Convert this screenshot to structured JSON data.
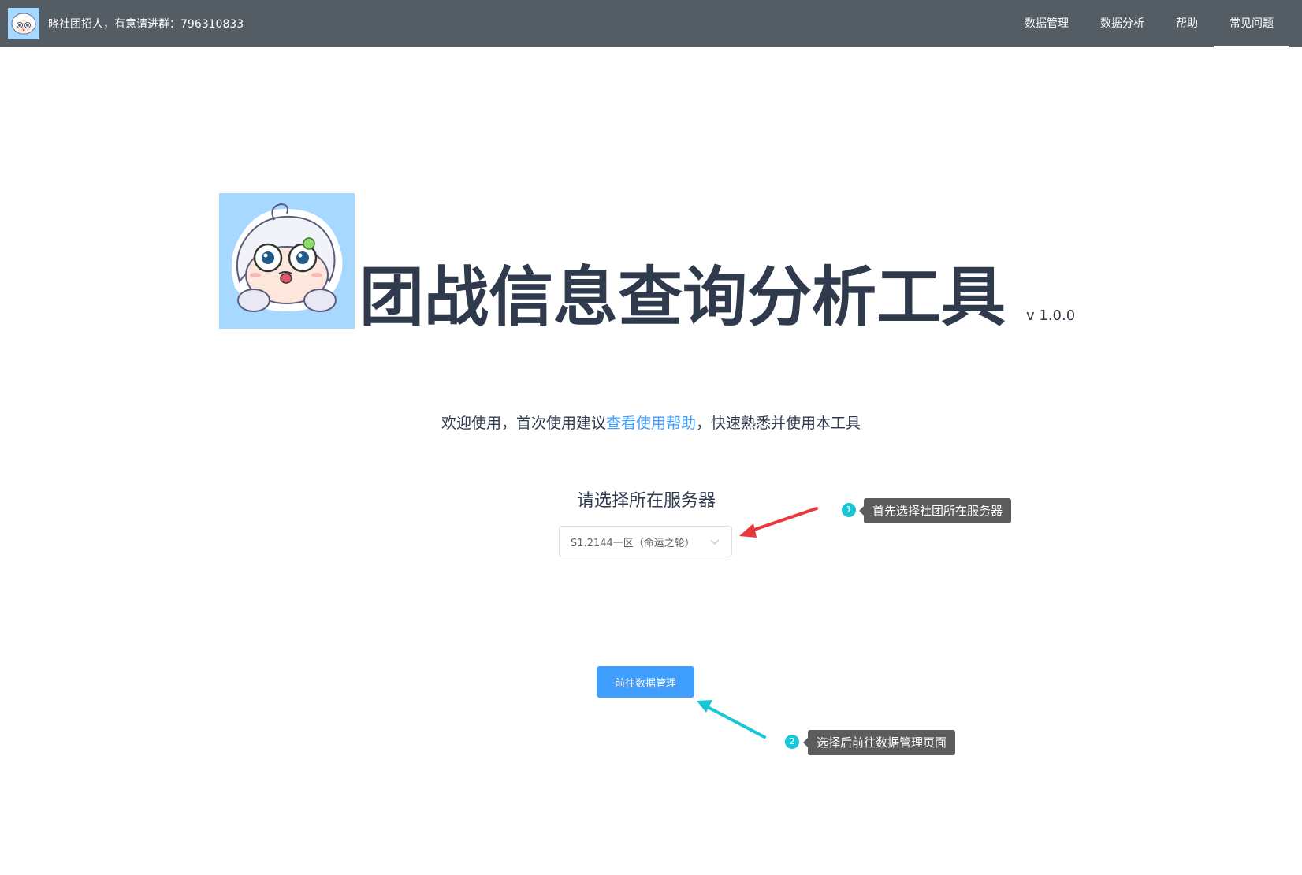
{
  "header": {
    "recruit_text": "晓社团招人，有意请进群：796310833",
    "nav": [
      {
        "label": "数据管理"
      },
      {
        "label": "数据分析"
      },
      {
        "label": "帮助"
      },
      {
        "label": "常见问题"
      }
    ],
    "bg_color": "#545c64"
  },
  "hero": {
    "title": "团战信息查询分析工具",
    "version": "v 1.0.0"
  },
  "welcome": {
    "prefix": "欢迎使用，首次使用建议",
    "link": "查看使用帮助",
    "suffix": "，快速熟悉并使用本工具"
  },
  "server": {
    "label": "请选择所在服务器",
    "selected": "S1.2144一区（命运之轮）"
  },
  "actions": {
    "go_label": "前往数据管理",
    "primary_color": "#409eff"
  },
  "annotations": [
    {
      "number": "1",
      "text": "首先选择社团所在服务器",
      "arrow_color": "#e8383d"
    },
    {
      "number": "2",
      "text": "选择后前往数据管理页面",
      "arrow_color": "#19c7d4"
    }
  ]
}
